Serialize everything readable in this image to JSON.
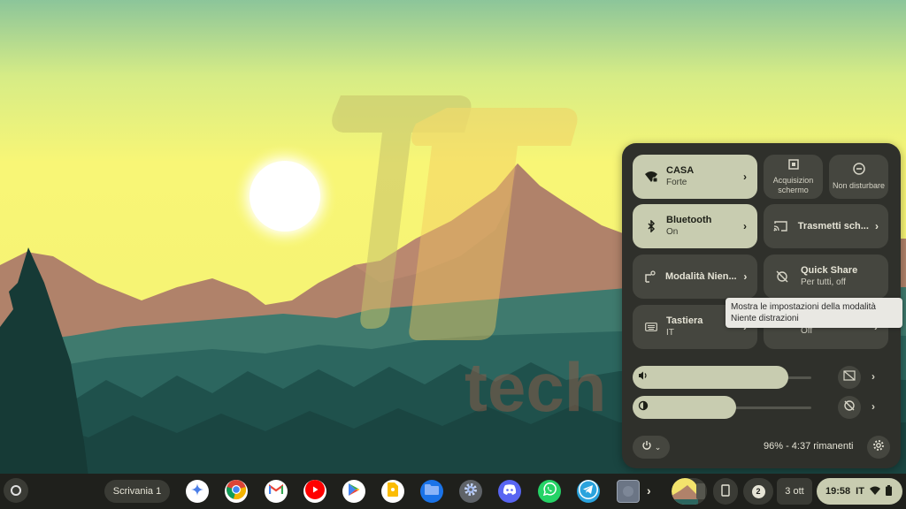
{
  "wallpaper": {
    "watermark_text": "tech",
    "colors": {
      "sky_top": "#8cc59a",
      "sky": "#f5f374",
      "sun": "#ffffff",
      "mountain": "#b0826a",
      "forest_far": "#3f7a6e",
      "forest_mid": "#2c665f",
      "forest_near": "#1c4a46",
      "tree_dark": "#163a36"
    }
  },
  "quick_settings": {
    "tiles": [
      {
        "id": "wifi",
        "label": "CASA",
        "sublabel": "Forte",
        "icon": "wifi-lock-icon",
        "state": "on",
        "has_chevron": true
      },
      {
        "id": "screen-capture",
        "label": "Acquisizion schermo",
        "icon": "screen-capture-icon",
        "state": "off"
      },
      {
        "id": "do-not-disturb",
        "label": "Non disturbare",
        "icon": "do-not-disturb-icon",
        "state": "off"
      },
      {
        "id": "bluetooth",
        "label": "Bluetooth",
        "sublabel": "On",
        "icon": "bluetooth-icon",
        "state": "on",
        "has_chevron": true
      },
      {
        "id": "cast",
        "label": "Trasmetti sch...",
        "icon": "cast-icon",
        "state": "off",
        "has_chevron": true
      },
      {
        "id": "focus-mode",
        "label": "Modalità Nien...",
        "icon": "focus-mode-icon",
        "state": "off",
        "has_chevron": true
      },
      {
        "id": "quick-share",
        "label": "Quick Share",
        "sublabel": "Per tutti, off",
        "icon": "quick-share-off-icon",
        "state": "off"
      },
      {
        "id": "keyboard",
        "label": "Tastiera",
        "sublabel": "IT",
        "icon": "keyboard-icon",
        "state": "off",
        "has_chevron": true
      },
      {
        "id": "hidden-tile",
        "label": "",
        "sublabel": "Off",
        "icon": "unknown-icon",
        "state": "off",
        "has_chevron": true
      }
    ],
    "volume": {
      "icon": "volume-icon",
      "level_percent": 87,
      "side_icon": "live-caption-off-icon"
    },
    "brightness": {
      "icon": "brightness-icon",
      "level_percent": 58,
      "side_icon": "night-light-off-icon"
    },
    "battery_text": "96% - 4:37 rimanenti",
    "tooltip": "Mostra le impostazioni della modalità Niente distrazioni"
  },
  "shelf": {
    "desk_label": "Scrivania 1",
    "apps": [
      {
        "name": "Gemini",
        "icon": "gemini-icon",
        "color": "#ffffff"
      },
      {
        "name": "Chrome",
        "icon": "chrome-icon",
        "color": "#ffffff"
      },
      {
        "name": "Gmail",
        "icon": "gmail-icon",
        "color": "#ffffff"
      },
      {
        "name": "YouTube",
        "icon": "youtube-icon",
        "color": "#ffffff"
      },
      {
        "name": "Play Store",
        "icon": "play-store-icon",
        "color": "#ffffff"
      },
      {
        "name": "Keep",
        "icon": "keep-icon",
        "color": "#ffffff"
      },
      {
        "name": "Files",
        "icon": "files-icon",
        "color": "#1a73e8"
      },
      {
        "name": "Settings",
        "icon": "settings-app-icon",
        "color": "#5f6368"
      },
      {
        "name": "Discord",
        "icon": "discord-icon",
        "color": "#5865f2"
      },
      {
        "name": "WhatsApp",
        "icon": "whatsapp-icon",
        "color": "#25d366"
      },
      {
        "name": "Telegram",
        "icon": "telegram-icon",
        "color": "#2aa3dd"
      },
      {
        "name": "App",
        "icon": "generic-app-icon",
        "color": "#6b7585"
      }
    ],
    "notification_count": "2",
    "date": "3 ott",
    "time": "19:58",
    "input_method": "IT"
  }
}
